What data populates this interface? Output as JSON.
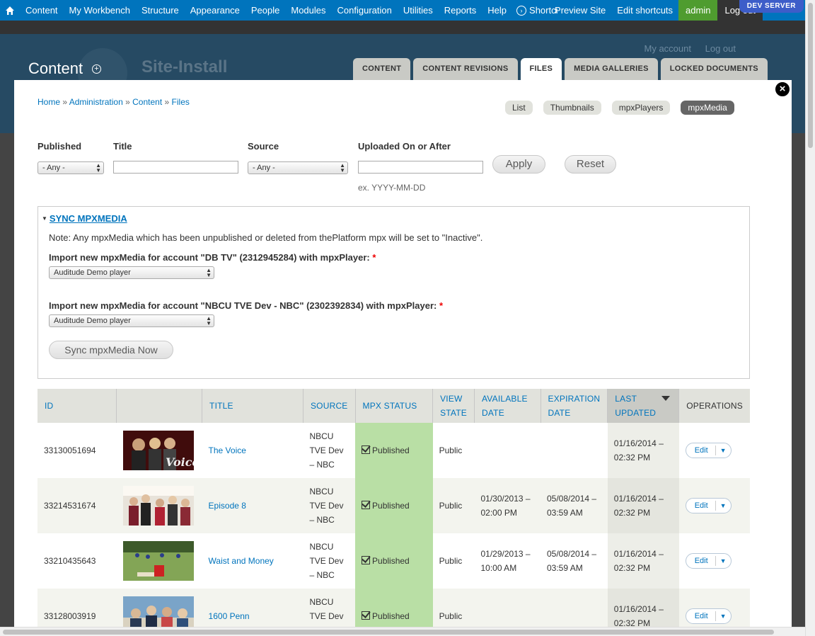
{
  "toolbar": {
    "items": [
      "Content",
      "My Workbench",
      "Structure",
      "Appearance",
      "People",
      "Modules",
      "Configuration",
      "Utilities",
      "Reports",
      "Help"
    ],
    "shortcuts_label": "Shortcuts",
    "preview_label": "Preview Site",
    "edit_shortcuts": "Edit shortcuts",
    "user": "admin",
    "logout": "Log out",
    "env_badge": "DEV SERVER"
  },
  "header": {
    "title": "Content",
    "site_name": "Site-Install",
    "secondary": [
      "My account",
      "Log out"
    ],
    "tabs": [
      "CONTENT",
      "CONTENT REVISIONS",
      "FILES",
      "MEDIA GALLERIES",
      "LOCKED DOCUMENTS"
    ],
    "active_tab": "FILES"
  },
  "breadcrumb": [
    "Home",
    "Administration",
    "Content",
    "Files"
  ],
  "breadcrumb_sep": "»",
  "view_switch": [
    "List",
    "Thumbnails",
    "mpxPlayers",
    "mpxMedia"
  ],
  "view_active": "mpxMedia",
  "filters": {
    "published_label": "Published",
    "published_value": "- Any -",
    "title_label": "Title",
    "title_value": "",
    "source_label": "Source",
    "source_value": "- Any -",
    "uploaded_label": "Uploaded On or After",
    "uploaded_value": "",
    "uploaded_hint": "ex. YYYY-MM-DD",
    "apply": "Apply",
    "reset": "Reset"
  },
  "sync": {
    "legend": "SYNC MPXMEDIA",
    "note": "Note: Any mpxMedia which has been unpublished or deleted from thePlatform mpx will be set to \"Inactive\".",
    "accounts": [
      {
        "label": "Import new mpxMedia for account \"DB TV\" (2312945284) with mpxPlayer:",
        "player": "Auditude Demo player"
      },
      {
        "label": "Import new mpxMedia for account \"NBCU TVE Dev - NBC\" (2302392834) with mpxPlayer:",
        "player": "Auditude Demo player"
      }
    ],
    "required_mark": "*",
    "button": "Sync mpxMedia Now"
  },
  "table": {
    "headers": {
      "id": "ID",
      "title": "TITLE",
      "source": "SOURCE",
      "status": "MPX STATUS",
      "view_state": "VIEW STATE",
      "available": "AVAILABLE DATE",
      "expiration": "EXPIRATION DATE",
      "updated": "LAST UPDATED",
      "ops": "OPERATIONS"
    },
    "rows": [
      {
        "id": "33130051694",
        "title": "The Voice",
        "source": "NBCU TVE Dev – NBC",
        "status": "Published",
        "view_state": "Public",
        "available": "",
        "expiration": "",
        "updated": "01/16/2014 – 02:32 PM",
        "op": "Edit"
      },
      {
        "id": "33214531674",
        "title": "Episode 8",
        "source": "NBCU TVE Dev – NBC",
        "status": "Published",
        "view_state": "Public",
        "available": "01/30/2013 – 02:00 PM",
        "expiration": "05/08/2014 – 03:59 AM",
        "updated": "01/16/2014 – 02:32 PM",
        "op": "Edit"
      },
      {
        "id": "33210435643",
        "title": "Waist and Money",
        "source": "NBCU TVE Dev – NBC",
        "status": "Published",
        "view_state": "Public",
        "available": "01/29/2013 – 10:00 AM",
        "expiration": "05/08/2014 – 03:59 AM",
        "updated": "01/16/2014 – 02:32 PM",
        "op": "Edit"
      },
      {
        "id": "33128003919",
        "title": "1600 Penn",
        "source": "NBCU TVE Dev – NBC",
        "status": "Published",
        "view_state": "Public",
        "available": "",
        "expiration": "",
        "updated": "01/16/2014 – 02:32 PM",
        "op": "Edit"
      }
    ]
  },
  "colors": {
    "toolbar": "#0074bd",
    "link": "#0074bd",
    "published_bg": "#b9dfa5",
    "header": "#264a63"
  }
}
